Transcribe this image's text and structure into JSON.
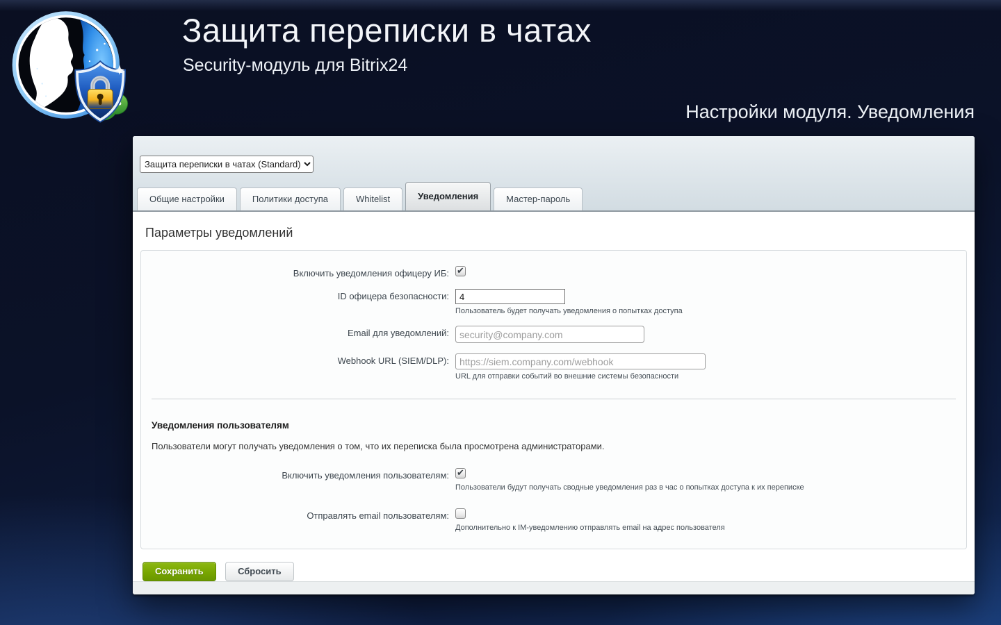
{
  "header": {
    "title": "Защита переписки в чатах",
    "subtitle": "Security-модуль для Bitrix24",
    "caption": "Настройки модуля. Уведомления"
  },
  "panel": {
    "module_select": {
      "value": "Защита переписки в чатах (Standard)"
    },
    "tabs": [
      {
        "label": "Общие настройки",
        "active": false
      },
      {
        "label": "Политики доступа",
        "active": false
      },
      {
        "label": "Whitelist",
        "active": false
      },
      {
        "label": "Уведомления",
        "active": true
      },
      {
        "label": "Мастер-пароль",
        "active": false
      }
    ],
    "section_title": "Параметры уведомлений",
    "officer": {
      "enable": {
        "label": "Включить уведомления офицеру ИБ:",
        "checked": true
      },
      "id": {
        "label": "ID офицера безопасности:",
        "value": "4",
        "hint": "Пользователь будет получать уведомления о попытках доступа"
      },
      "email": {
        "label": "Email для уведомлений:",
        "placeholder": "security@company.com"
      },
      "webhook": {
        "label": "Webhook URL (SIEM/DLP):",
        "placeholder": "https://siem.company.com/webhook",
        "hint": "URL для отправки событий во внешние системы безопасности"
      }
    },
    "users": {
      "title": "Уведомления пользователям",
      "description": "Пользователи могут получать уведомления о том, что их переписка была просмотрена администраторами.",
      "enable": {
        "label": "Включить уведомления пользователям:",
        "checked": true,
        "hint": "Пользователи будут получать сводные уведомления раз в час о попытках доступа к их переписке"
      },
      "email": {
        "label": "Отправлять email пользователям:",
        "checked": false,
        "hint": "Дополнительно к IM-уведомлению отправлять email на адрес пользователя"
      }
    },
    "buttons": {
      "save": "Сохранить",
      "reset": "Сбросить"
    }
  },
  "colors": {
    "background_navy": "#0c1430",
    "accent_blue": "#2f6fd0",
    "save_green": "#76a400",
    "panel_header_gray": "#dde5ea",
    "footer_gray": "#edf0f1"
  }
}
